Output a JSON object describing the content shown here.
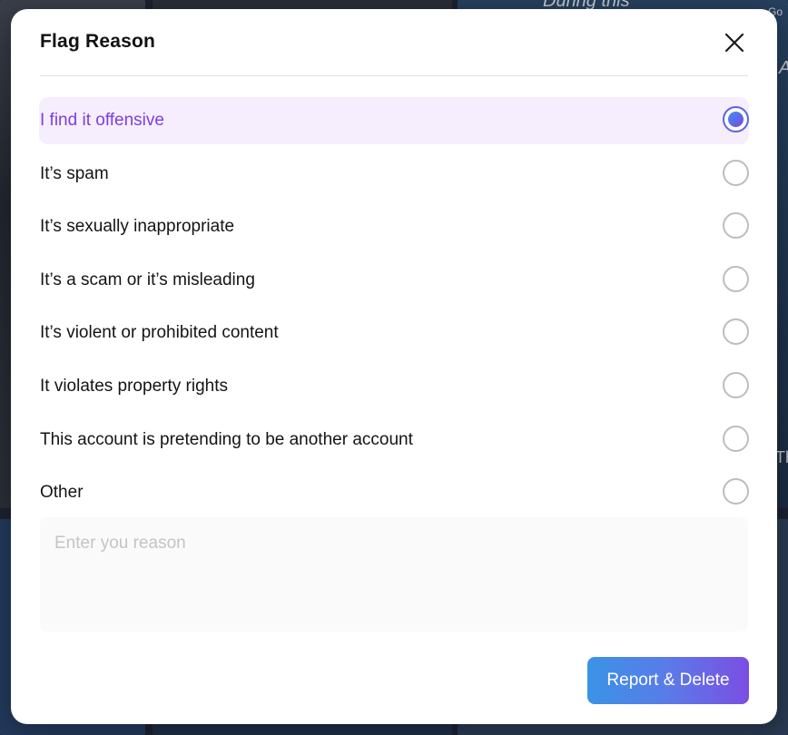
{
  "modal": {
    "title": "Flag Reason",
    "options": [
      {
        "label": "I find it offensive",
        "selected": true
      },
      {
        "label": "It’s spam",
        "selected": false
      },
      {
        "label": "It’s sexually inappropriate",
        "selected": false
      },
      {
        "label": "It’s a scam or it’s misleading",
        "selected": false
      },
      {
        "label": "It’s violent or prohibited content",
        "selected": false
      },
      {
        "label": "It violates property rights",
        "selected": false
      },
      {
        "label": "This account is pretending to be another account",
        "selected": false
      },
      {
        "label": "Other",
        "selected": false
      }
    ],
    "reason_placeholder": "Enter you reason",
    "submit_label": "Report & Delete",
    "close_icon": "close-icon"
  },
  "background": {
    "texts": [
      "During this",
      "Go",
      "A",
      "Th"
    ]
  },
  "colors": {
    "accent": "#7b3fe0",
    "selected_bg": "#f6eefc",
    "button_gradient_start": "#3b93e6",
    "button_gradient_end": "#7b4ee3"
  }
}
